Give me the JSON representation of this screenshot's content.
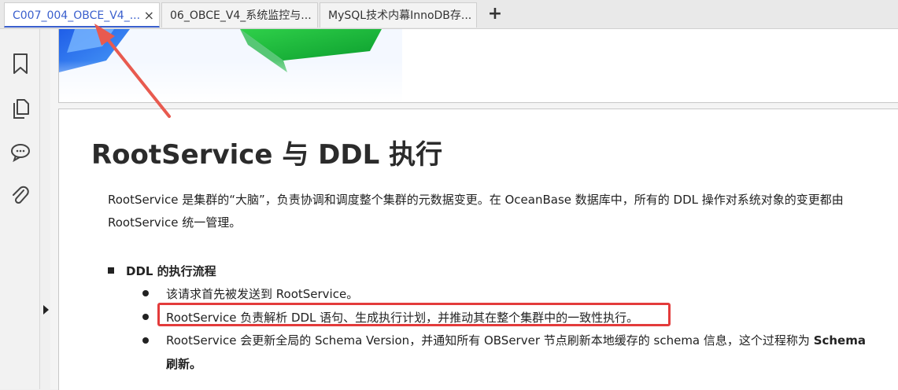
{
  "tabs": [
    {
      "label": "C007_004_OBCE_V4_...",
      "active": true,
      "close": "×"
    },
    {
      "label": "06_OBCE_V4_系统监控与...",
      "active": false
    },
    {
      "label": "MySQL技术内幕InnoDB存...",
      "active": false
    }
  ],
  "new_tab_label": "+",
  "sidebar": {
    "icons": [
      "bookmark-icon",
      "pages-icon",
      "comments-icon",
      "attachment-icon"
    ]
  },
  "document": {
    "heading": "RootService 与 DDL 执行",
    "paragraph_line1": "RootService 是集群的“大脑”，负责协调和调度整个集群的元数据变更。在 OceanBase 数据库中，所有的 DDL 操作对系统对象的变更都由",
    "paragraph_line2": "RootService 统一管理。",
    "section_title": "DDL 的执行流程",
    "bullets": [
      "该请求首先被发送到 RootService。",
      "RootService 负责解析 DDL 语句、生成执行计划，并推动其在整个集群中的一致性执行。",
      "RootService 会更新全局的 Schema Version，并通知所有 OBServer 节点刷新本地缓存的 schema 信息，这个过程称为"
    ],
    "bullet3_bold_tail": "Schema",
    "bullet3_line2": "刷新。"
  },
  "colors": {
    "active_tab": "#3a5fcd",
    "highlight_box": "#e33b3b",
    "annotation_arrow": "#e85a4f"
  }
}
